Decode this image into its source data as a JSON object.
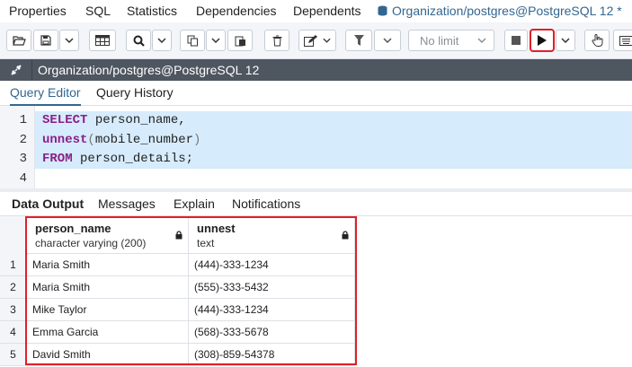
{
  "top_tabs": [
    {
      "label": "Properties"
    },
    {
      "label": "SQL"
    },
    {
      "label": "Statistics"
    },
    {
      "label": "Dependencies"
    },
    {
      "label": "Dependents"
    },
    {
      "label": "Organization/postgres@PostgreSQL 12 *",
      "active": true
    }
  ],
  "toolbar": {
    "limit_label": "No limit"
  },
  "connection": {
    "label": "Organization/postgres@PostgreSQL 12"
  },
  "query_tabs": [
    {
      "label": "Query Editor",
      "active": true
    },
    {
      "label": "Query History"
    }
  ],
  "editor": {
    "line_numbers": [
      "1",
      "2",
      "3",
      "4"
    ],
    "lines": [
      {
        "kw": "SELECT",
        "rest": " person_name,"
      },
      {
        "fn": "unnest",
        "open": "(",
        "arg": "mobile_number",
        "close": ")"
      },
      {
        "kw": "FROM",
        "rest": " person_details;"
      },
      {}
    ]
  },
  "output_tabs": [
    {
      "label": "Data Output",
      "active": true
    },
    {
      "label": "Messages"
    },
    {
      "label": "Explain"
    },
    {
      "label": "Notifications"
    }
  ],
  "result": {
    "columns": [
      {
        "name": "person_name",
        "type": "character varying (200)"
      },
      {
        "name": "unnest",
        "type": "text"
      }
    ],
    "rows": [
      {
        "n": "1",
        "person_name": "Maria Smith",
        "unnest": "(444)-333-1234"
      },
      {
        "n": "2",
        "person_name": "Maria Smith",
        "unnest": "(555)-333-5432"
      },
      {
        "n": "3",
        "person_name": "Mike Taylor",
        "unnest": "(444)-333-1234"
      },
      {
        "n": "4",
        "person_name": "Emma Garcia",
        "unnest": "(568)-333-5678"
      },
      {
        "n": "5",
        "person_name": "David Smith",
        "unnest": "(308)-859-54378"
      }
    ]
  },
  "colors": {
    "accent": "#326690",
    "highlight": "#e02027",
    "keyword": "#8a1f88",
    "connection_bar": "#4e5660"
  }
}
